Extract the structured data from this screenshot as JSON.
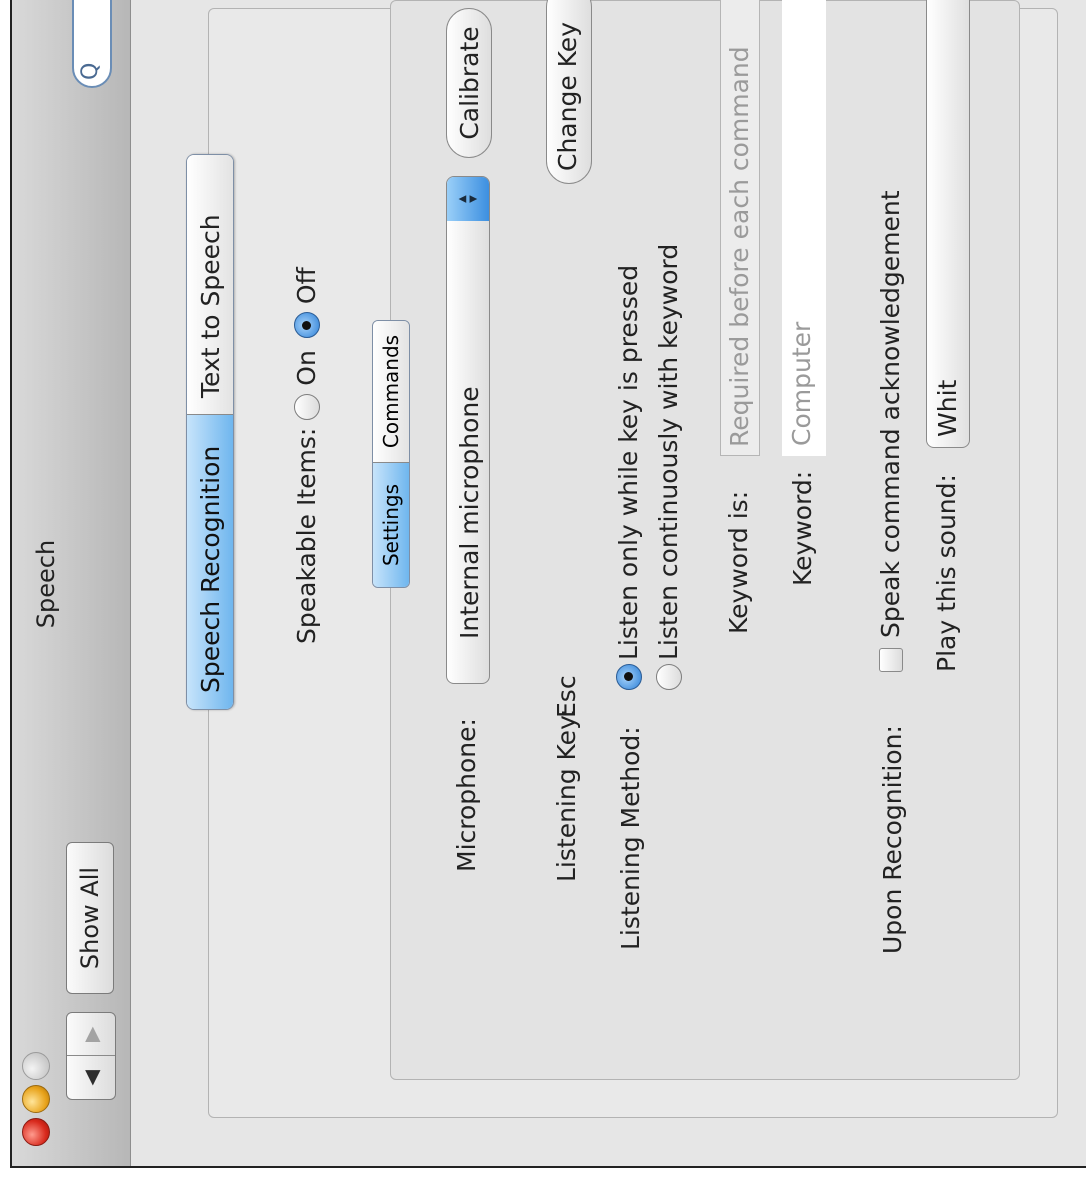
{
  "window": {
    "title": "Speech",
    "nav_back": "◀",
    "nav_forward": "▶",
    "show_all": "Show All",
    "search_icon": "Q"
  },
  "tabs": [
    {
      "label": "Speech Recognition",
      "selected": true
    },
    {
      "label": "Text to Speech",
      "selected": false
    }
  ],
  "speakable": {
    "label": "Speakable Items:",
    "on_label": "On",
    "off_label": "Off",
    "selected": "Off"
  },
  "subtabs": [
    {
      "label": "Settings",
      "selected": true
    },
    {
      "label": "Commands",
      "selected": false
    }
  ],
  "microphone": {
    "label": "Microphone:",
    "value": "Internal microphone",
    "calibrate_label": "Calibrate"
  },
  "listening_key": {
    "label": "Listening Key:",
    "value": "Esc",
    "change_label": "Change Key"
  },
  "listening_method": {
    "label": "Listening Method:",
    "options": [
      "Listen only while key is pressed",
      "Listen continuously with keyword"
    ],
    "selected_index": 0
  },
  "keyword_is": {
    "label": "Keyword is:",
    "value": "Required before each command"
  },
  "keyword": {
    "label": "Keyword:",
    "value": "Computer"
  },
  "upon_recognition": {
    "label": "Upon Recognition:",
    "speak_ack_label": "Speak command acknowledgement",
    "speak_ack_checked": false,
    "play_sound_label": "Play this sound:",
    "sound_value": "Whit"
  },
  "colors": {
    "selected_tab": "#6fb6ee",
    "close_button": "#d8291c",
    "minimize_button": "#e8a31b"
  }
}
